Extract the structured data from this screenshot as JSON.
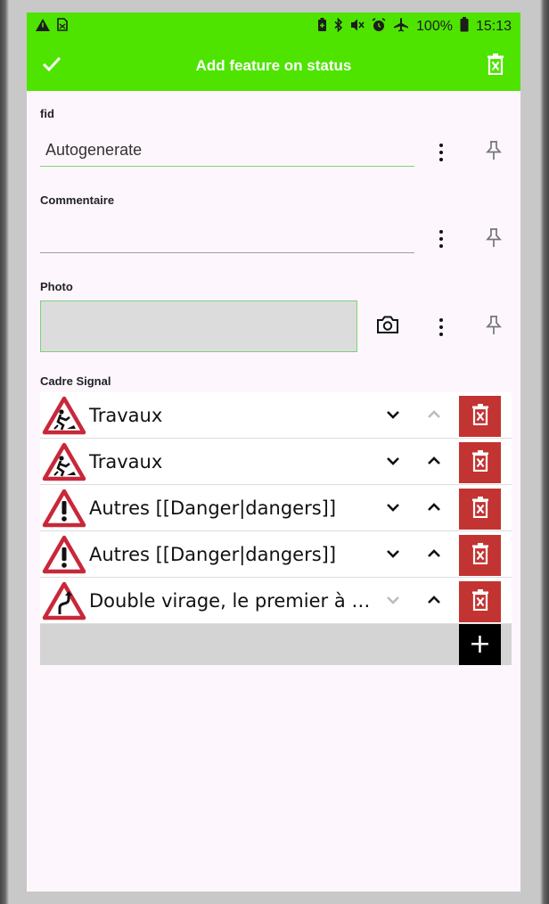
{
  "status_bar": {
    "battery_percent": "100%",
    "time": "15:13"
  },
  "app_bar": {
    "title": "Add feature on status"
  },
  "fields": {
    "fid": {
      "label": "fid",
      "value": "Autogenerate"
    },
    "commentaire": {
      "label": "Commentaire",
      "value": ""
    },
    "photo": {
      "label": "Photo"
    },
    "cadre_signal": {
      "label": "Cadre Signal"
    }
  },
  "relations": [
    {
      "text": "Travaux",
      "sign": "roadworks",
      "down_enabled": true,
      "up_enabled": false
    },
    {
      "text": "Travaux",
      "sign": "roadworks",
      "down_enabled": true,
      "up_enabled": true
    },
    {
      "text": "Autres [[Danger|dangers]]",
      "sign": "exclamation",
      "down_enabled": true,
      "up_enabled": true
    },
    {
      "text": "Autres [[Danger|dangers]]",
      "sign": "exclamation",
      "down_enabled": true,
      "up_enabled": true
    },
    {
      "text": "Double virage, le premier à gauche",
      "sign": "double-bend",
      "down_enabled": false,
      "up_enabled": true
    }
  ],
  "add_button": {
    "label": "+"
  },
  "colors": {
    "accent": "#4ee400",
    "delete": "#c23432",
    "focus_line": "#7dd27a"
  }
}
